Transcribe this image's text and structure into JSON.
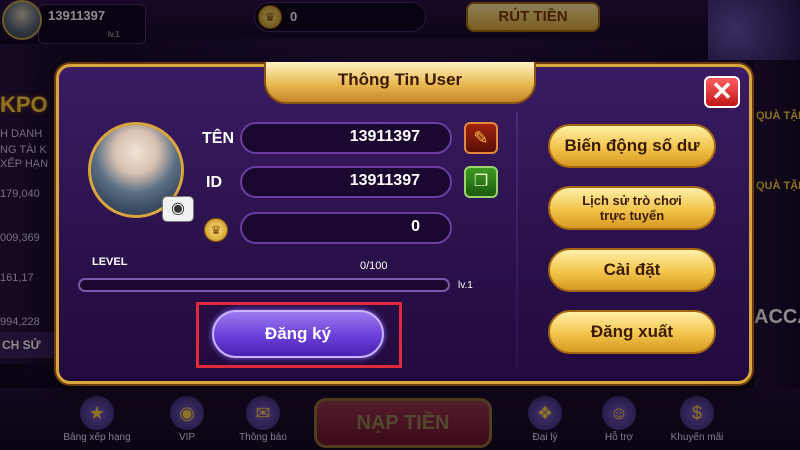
{
  "lobby": {
    "username": "13911397",
    "level": "lv.1",
    "coins": "0",
    "withdraw_label": "RÚT TIỀN",
    "jackpot_label": "KPO",
    "left_texts": [
      "H DANH",
      "NG TÀI K",
      "XẾP HẠN",
      "179,040",
      "009,369",
      "161,17",
      "994,228"
    ],
    "left_bottom_label": "CH SỬ",
    "right_texts": [
      "QUÀ TẶNG",
      "QUÀ TẶN"
    ],
    "right_bottom_label": "ACCA",
    "bottom_nav": [
      {
        "label": "Bảng xếp hạng",
        "icon": "trophy-icon"
      },
      {
        "label": "VIP",
        "icon": "vip-wheel-icon"
      },
      {
        "label": "Thông báo",
        "icon": "notification-icon"
      },
      {
        "label": "Đại lý",
        "icon": "gift-icon"
      },
      {
        "label": "Hỗ trợ",
        "icon": "support-icon"
      },
      {
        "label": "Khuyến mãi",
        "icon": "dollar-coin-icon"
      }
    ],
    "deposit_label": "NẠP TIỀN"
  },
  "modal": {
    "title": "Thông Tin User",
    "close_label": "✕",
    "fields": {
      "name_label": "TÊN",
      "name_value": "13911397",
      "id_label": "ID",
      "id_value": "13911397",
      "balance_value": "0"
    },
    "level": {
      "label": "LEVEL",
      "progress_text": "0/100",
      "progress_fraction": 0.0,
      "tag": "lv.1"
    },
    "register_label": "Đăng ký",
    "menu": {
      "balance_history": "Biến động số dư",
      "game_history_line1": "Lịch sử trò chơi",
      "game_history_line2": "trực tuyến",
      "settings": "Cài đặt",
      "logout": "Đăng xuất"
    }
  }
}
